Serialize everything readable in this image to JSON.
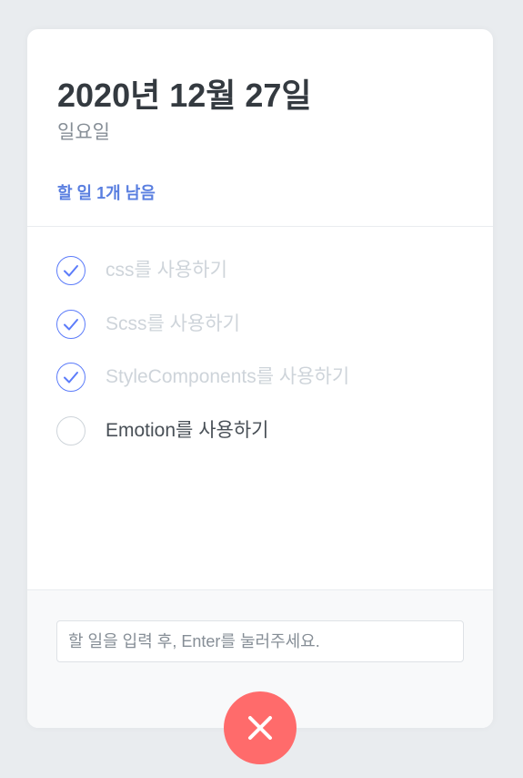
{
  "header": {
    "date": "2020년 12월 27일",
    "day": "일요일",
    "tasks_left": "할 일 1개 남음"
  },
  "todos": [
    {
      "text": "css를 사용하기",
      "done": true
    },
    {
      "text": "Scss를 사용하기",
      "done": true
    },
    {
      "text": "StyleComponents를 사용하기",
      "done": true
    },
    {
      "text": "Emotion를 사용하기",
      "done": false
    }
  ],
  "input": {
    "placeholder": "할 일을 입력 후, Enter를 눌러주세요.",
    "value": ""
  },
  "close_button": {
    "icon": "close-icon"
  },
  "colors": {
    "accent": "#5c7cfa",
    "close": "#ff6b6b",
    "done_text": "#ced4da"
  }
}
